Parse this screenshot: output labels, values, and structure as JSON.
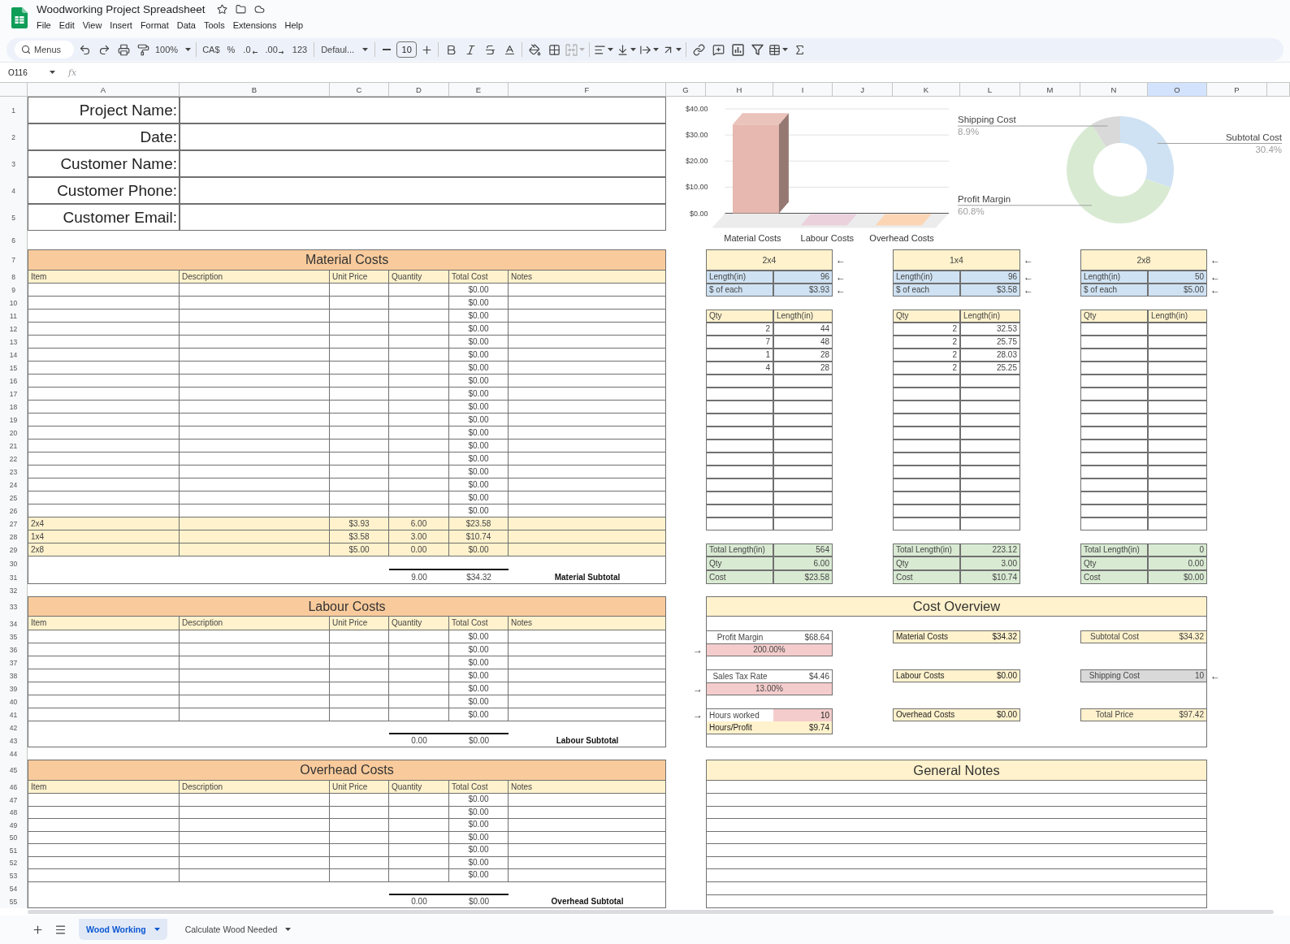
{
  "app": {
    "title": "Woodworking Project Spreadsheet",
    "menus": [
      "File",
      "Edit",
      "View",
      "Insert",
      "Format",
      "Data",
      "Tools",
      "Extensions",
      "Help"
    ]
  },
  "toolbar": {
    "search": {
      "placeholder": "Menus"
    },
    "zoom": "100%",
    "currency": "CA$",
    "percent": "%",
    "decrease_decimals": ".0",
    "increase_decimals": ".00",
    "number_format": "123",
    "font": "Defaul...",
    "font_size": "10"
  },
  "formula_bar": {
    "cell_ref": "O116",
    "function_label": "fx"
  },
  "sheet": {
    "columns": [
      {
        "label": "A",
        "selected": false
      },
      {
        "label": "B",
        "selected": false
      },
      {
        "label": "C",
        "selected": false
      },
      {
        "label": "D",
        "selected": false
      },
      {
        "label": "E",
        "selected": false
      },
      {
        "label": "F",
        "selected": false
      },
      {
        "label": "G",
        "selected": false
      },
      {
        "label": "H",
        "selected": false
      },
      {
        "label": "I",
        "selected": false
      },
      {
        "label": "J",
        "selected": false
      },
      {
        "label": "K",
        "selected": false
      },
      {
        "label": "L",
        "selected": false
      },
      {
        "label": "M",
        "selected": false
      },
      {
        "label": "N",
        "selected": false
      },
      {
        "label": "O",
        "selected": true
      },
      {
        "label": "P",
        "selected": false
      }
    ],
    "row_numbers": [
      "1",
      "2",
      "3",
      "4",
      "5",
      "6",
      "7",
      "8",
      "9",
      "10",
      "11",
      "12",
      "13",
      "14",
      "15",
      "16",
      "17",
      "18",
      "19",
      "20",
      "21",
      "22",
      "23",
      "24",
      "25",
      "26",
      "27",
      "28",
      "29",
      "30",
      "31",
      "32",
      "33",
      "34",
      "35",
      "36",
      "37",
      "38",
      "39",
      "40",
      "41",
      "42",
      "43",
      "44",
      "45",
      "46",
      "47",
      "48",
      "49",
      "50",
      "51",
      "52",
      "53",
      "54",
      "55"
    ],
    "project_fields": [
      "Project Name:",
      "Date:",
      "Customer Name:",
      "Customer Phone:",
      "Customer Email:"
    ],
    "bar_chart": {
      "chart_data": {
        "type": "bar",
        "categories": [
          "Material Costs",
          "Labour Costs",
          "Overhead Costs"
        ],
        "values": [
          34,
          0,
          0
        ],
        "colors": [
          "#e6b8af",
          "#ead1dc",
          "#fcd5b4"
        ],
        "ylim": [
          0,
          40
        ],
        "yticks": [
          {
            "value": 0,
            "label": "$0.00"
          },
          {
            "value": 10,
            "label": "$10.00"
          },
          {
            "value": 20,
            "label": "$20.00"
          },
          {
            "value": 30,
            "label": "$30.00"
          },
          {
            "value": 40,
            "label": "$40.00"
          }
        ],
        "grid": true
      }
    },
    "donut_chart": {
      "chart_data": {
        "type": "donut",
        "categories": [
          "Subtotal Cost",
          "Profit Margin",
          "Shipping Cost"
        ],
        "values": [
          30.4,
          60.8,
          8.9
        ],
        "colors": [
          "#cfe2f3",
          "#d9ead3",
          "#d9d9d9"
        ],
        "value_labels": [
          "30.4%",
          "60.8%",
          "8.9%"
        ]
      }
    },
    "cost_tables": [
      {
        "title": "Material Costs",
        "headers": [
          "Item",
          "Description",
          "Unit Price",
          "Quantity",
          "Total Cost",
          "Notes"
        ],
        "rows": [
          {
            "highlighted": false,
            "total_cost": "$0.00"
          },
          {
            "highlighted": false,
            "total_cost": "$0.00"
          },
          {
            "highlighted": false,
            "total_cost": "$0.00"
          },
          {
            "highlighted": false,
            "total_cost": "$0.00"
          },
          {
            "highlighted": false,
            "total_cost": "$0.00"
          },
          {
            "highlighted": false,
            "total_cost": "$0.00"
          },
          {
            "highlighted": false,
            "total_cost": "$0.00"
          },
          {
            "highlighted": false,
            "total_cost": "$0.00"
          },
          {
            "highlighted": false,
            "total_cost": "$0.00"
          },
          {
            "highlighted": false,
            "total_cost": "$0.00"
          },
          {
            "highlighted": false,
            "total_cost": "$0.00"
          },
          {
            "highlighted": false,
            "total_cost": "$0.00"
          },
          {
            "highlighted": false,
            "total_cost": "$0.00"
          },
          {
            "highlighted": false,
            "total_cost": "$0.00"
          },
          {
            "highlighted": false,
            "total_cost": "$0.00"
          },
          {
            "highlighted": false,
            "total_cost": "$0.00"
          },
          {
            "highlighted": false,
            "total_cost": "$0.00"
          },
          {
            "highlighted": false,
            "total_cost": "$0.00"
          },
          {
            "highlighted": true,
            "item": "2x4",
            "unit_price": "$3.93",
            "quantity": "6.00",
            "total_cost": "$23.58"
          },
          {
            "highlighted": true,
            "item": "1x4",
            "unit_price": "$3.58",
            "quantity": "3.00",
            "total_cost": "$10.74"
          },
          {
            "highlighted": true,
            "item": "2x8",
            "unit_price": "$5.00",
            "quantity": "0.00",
            "total_cost": "$0.00"
          }
        ],
        "subtotal": {
          "quantity": "9.00",
          "total_cost": "$34.32",
          "label": "Material Subtotal"
        }
      },
      {
        "title": "Labour Costs",
        "headers": [
          "Item",
          "Description",
          "Unit Price",
          "Quantity",
          "Total Cost",
          "Notes"
        ],
        "rows": [
          {
            "highlighted": false,
            "total_cost": "$0.00"
          },
          {
            "highlighted": false,
            "total_cost": "$0.00"
          },
          {
            "highlighted": false,
            "total_cost": "$0.00"
          },
          {
            "highlighted": false,
            "total_cost": "$0.00"
          },
          {
            "highlighted": false,
            "total_cost": "$0.00"
          },
          {
            "highlighted": false,
            "total_cost": "$0.00"
          },
          {
            "highlighted": false,
            "total_cost": "$0.00"
          }
        ],
        "subtotal": {
          "quantity": "0.00",
          "total_cost": "$0.00",
          "label": "Labour Subtotal"
        }
      },
      {
        "title": "Overhead Costs",
        "headers": [
          "Item",
          "Description",
          "Unit Price",
          "Quantity",
          "Total Cost",
          "Notes"
        ],
        "rows": [
          {
            "highlighted": false,
            "total_cost": "$0.00"
          },
          {
            "highlighted": false,
            "total_cost": "$0.00"
          },
          {
            "highlighted": false,
            "total_cost": "$0.00"
          },
          {
            "highlighted": false,
            "total_cost": "$0.00"
          },
          {
            "highlighted": false,
            "total_cost": "$0.00"
          },
          {
            "highlighted": false,
            "total_cost": "$0.00"
          },
          {
            "highlighted": false,
            "total_cost": "$0.00"
          }
        ],
        "subtotal": {
          "quantity": "0.00",
          "total_cost": "$0.00",
          "label": "Overhead Subtotal"
        }
      }
    ],
    "lumber_blocks": [
      {
        "title": "2x4",
        "title_pointer": "←",
        "specs": [
          {
            "label": "Length(in)",
            "value": "96",
            "pointer": "←"
          },
          {
            "label": "$ of each",
            "value": "$3.93",
            "pointer": "←"
          }
        ],
        "cut_headers": [
          "Qty",
          "Length(in)"
        ],
        "cuts": [
          {
            "qty": "2",
            "length": "44"
          },
          {
            "qty": "7",
            "length": "48"
          },
          {
            "qty": "1",
            "length": "28"
          },
          {
            "qty": "4",
            "length": "28"
          }
        ],
        "totals": [
          {
            "label": "Total Length(in)",
            "value": "564"
          },
          {
            "label": "Qty",
            "value": "6.00"
          },
          {
            "label": "Cost",
            "value": "$23.58"
          }
        ]
      },
      {
        "title": "1x4",
        "title_pointer": "←",
        "specs": [
          {
            "label": "Length(in)",
            "value": "96",
            "pointer": "←"
          },
          {
            "label": "$ of each",
            "value": "$3.58",
            "pointer": "←"
          }
        ],
        "cut_headers": [
          "Qty",
          "Length(in)"
        ],
        "cuts": [
          {
            "qty": "2",
            "length": "32.53"
          },
          {
            "qty": "2",
            "length": "25.75"
          },
          {
            "qty": "2",
            "length": "28.03"
          },
          {
            "qty": "2",
            "length": "25.25"
          }
        ],
        "totals": [
          {
            "label": "Total Length(in)",
            "value": "223.12"
          },
          {
            "label": "Qty",
            "value": "3.00"
          },
          {
            "label": "Cost",
            "value": "$10.74"
          }
        ]
      },
      {
        "title": "2x8",
        "title_pointer": "←",
        "specs": [
          {
            "label": "Length(in)",
            "value": "50",
            "pointer": "←"
          },
          {
            "label": "$ of each",
            "value": "$5.00",
            "pointer": "←"
          }
        ],
        "cut_headers": [
          "Qty",
          "Length(in)"
        ],
        "totals": [
          {
            "label": "Total Length(in)",
            "value": "0"
          },
          {
            "label": "Qty",
            "value": "0.00"
          },
          {
            "label": "Cost",
            "value": "$0.00"
          }
        ]
      }
    ],
    "cost_overview": {
      "title": "Cost Overview",
      "adjustments": [
        {
          "kind": "rate",
          "label": "Profit Margin",
          "amount": "$68.64",
          "input": "200.00%",
          "pointer": "→"
        },
        {
          "kind": "rate",
          "label": "Sales Tax Rate",
          "amount": "$4.46",
          "input": "13.00%",
          "pointer": "→"
        },
        {
          "kind": "hours",
          "label": "Hours worked",
          "input": "10",
          "pointer": "→",
          "result_label": "Hours/Profit",
          "result": "$9.74"
        }
      ],
      "costs": [
        {
          "label": "Material Costs",
          "value": "$34.32"
        },
        {
          "label": "Labour Costs",
          "value": "$0.00"
        },
        {
          "label": "Overhead Costs",
          "value": "$0.00"
        }
      ],
      "totals": [
        {
          "kind": "computed",
          "label": "Subtotal Cost",
          "value": "$34.32"
        },
        {
          "kind": "input",
          "label": "Shipping Cost",
          "value": "10",
          "pointer": "←"
        },
        {
          "kind": "computed",
          "label": "Total Price",
          "value": "$97.42"
        }
      ]
    },
    "general_notes": {
      "title": "General Notes"
    }
  },
  "sheet_tabs": [
    {
      "label": "Wood Working",
      "selected": true
    },
    {
      "label": "Calculate Wood Needed",
      "selected": false
    }
  ]
}
